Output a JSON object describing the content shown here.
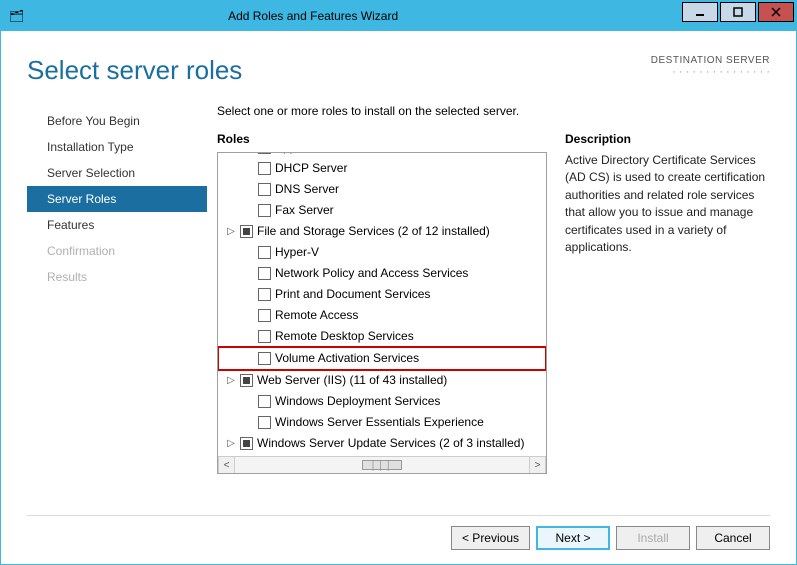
{
  "window": {
    "title": "Add Roles and Features Wizard"
  },
  "header": {
    "page_title": "Select server roles",
    "destination_label": "DESTINATION SERVER",
    "destination_server": "· · · · · · · · · · · · · · ·"
  },
  "nav": {
    "items": [
      {
        "label": "Before You Begin",
        "state": "normal"
      },
      {
        "label": "Installation Type",
        "state": "normal"
      },
      {
        "label": "Server Selection",
        "state": "normal"
      },
      {
        "label": "Server Roles",
        "state": "selected"
      },
      {
        "label": "Features",
        "state": "normal"
      },
      {
        "label": "Confirmation",
        "state": "disabled"
      },
      {
        "label": "Results",
        "state": "disabled"
      }
    ]
  },
  "main": {
    "instruction": "Select one or more roles to install on the selected server.",
    "roles_heading": "Roles",
    "description_heading": "Description",
    "description_text": "Active Directory Certificate Services (AD CS) is used to create certification authorities and related role services that allow you to issue and manage certificates used in a variety of applications.",
    "roles": [
      {
        "label": "DHCP Server",
        "checked": false,
        "expandable": false,
        "indent": 1
      },
      {
        "label": "DNS Server",
        "checked": false,
        "expandable": false,
        "indent": 1
      },
      {
        "label": "Fax Server",
        "checked": false,
        "expandable": false,
        "indent": 1
      },
      {
        "label": "File and Storage Services (2 of 12 installed)",
        "checked": "partial",
        "expandable": true,
        "indent": 0
      },
      {
        "label": "Hyper-V",
        "checked": false,
        "expandable": false,
        "indent": 1
      },
      {
        "label": "Network Policy and Access Services",
        "checked": false,
        "expandable": false,
        "indent": 1
      },
      {
        "label": "Print and Document Services",
        "checked": false,
        "expandable": false,
        "indent": 1
      },
      {
        "label": "Remote Access",
        "checked": false,
        "expandable": false,
        "indent": 1
      },
      {
        "label": "Remote Desktop Services",
        "checked": false,
        "expandable": false,
        "indent": 1
      },
      {
        "label": "Volume Activation Services",
        "checked": false,
        "expandable": false,
        "indent": 1,
        "highlight": true
      },
      {
        "label": "Web Server (IIS) (11 of 43 installed)",
        "checked": "partial",
        "expandable": true,
        "indent": 0
      },
      {
        "label": "Windows Deployment Services",
        "checked": false,
        "expandable": false,
        "indent": 1
      },
      {
        "label": "Windows Server Essentials Experience",
        "checked": false,
        "expandable": false,
        "indent": 1
      },
      {
        "label": "Windows Server Update Services (2 of 3 installed)",
        "checked": "partial",
        "expandable": true,
        "indent": 0
      }
    ]
  },
  "footer": {
    "previous": "< Previous",
    "next": "Next >",
    "install": "Install",
    "cancel": "Cancel"
  }
}
